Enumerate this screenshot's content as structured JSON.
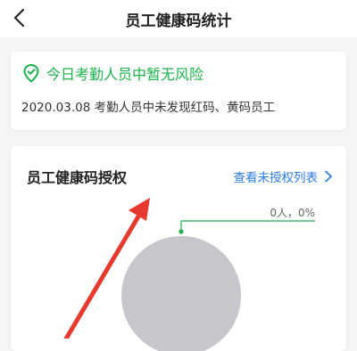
{
  "header": {
    "title": "员工健康码统计"
  },
  "status": {
    "title": "今日考勤人员中暂无风险",
    "description": "2020.03.08 考勤人员中未发现红码、黄码员工",
    "color": "#19b24b"
  },
  "auth_section": {
    "title": "员工健康码授权",
    "link_label": "查看未授权列表",
    "link_color": "#2b7ce8"
  },
  "chart_data": {
    "type": "pie",
    "slices": [
      {
        "label": "0人，0%",
        "value": 0,
        "color": "#19b24b"
      },
      {
        "value": 100,
        "color": "#c6c6cc"
      }
    ]
  },
  "annotation": {
    "color": "#e8392e"
  }
}
